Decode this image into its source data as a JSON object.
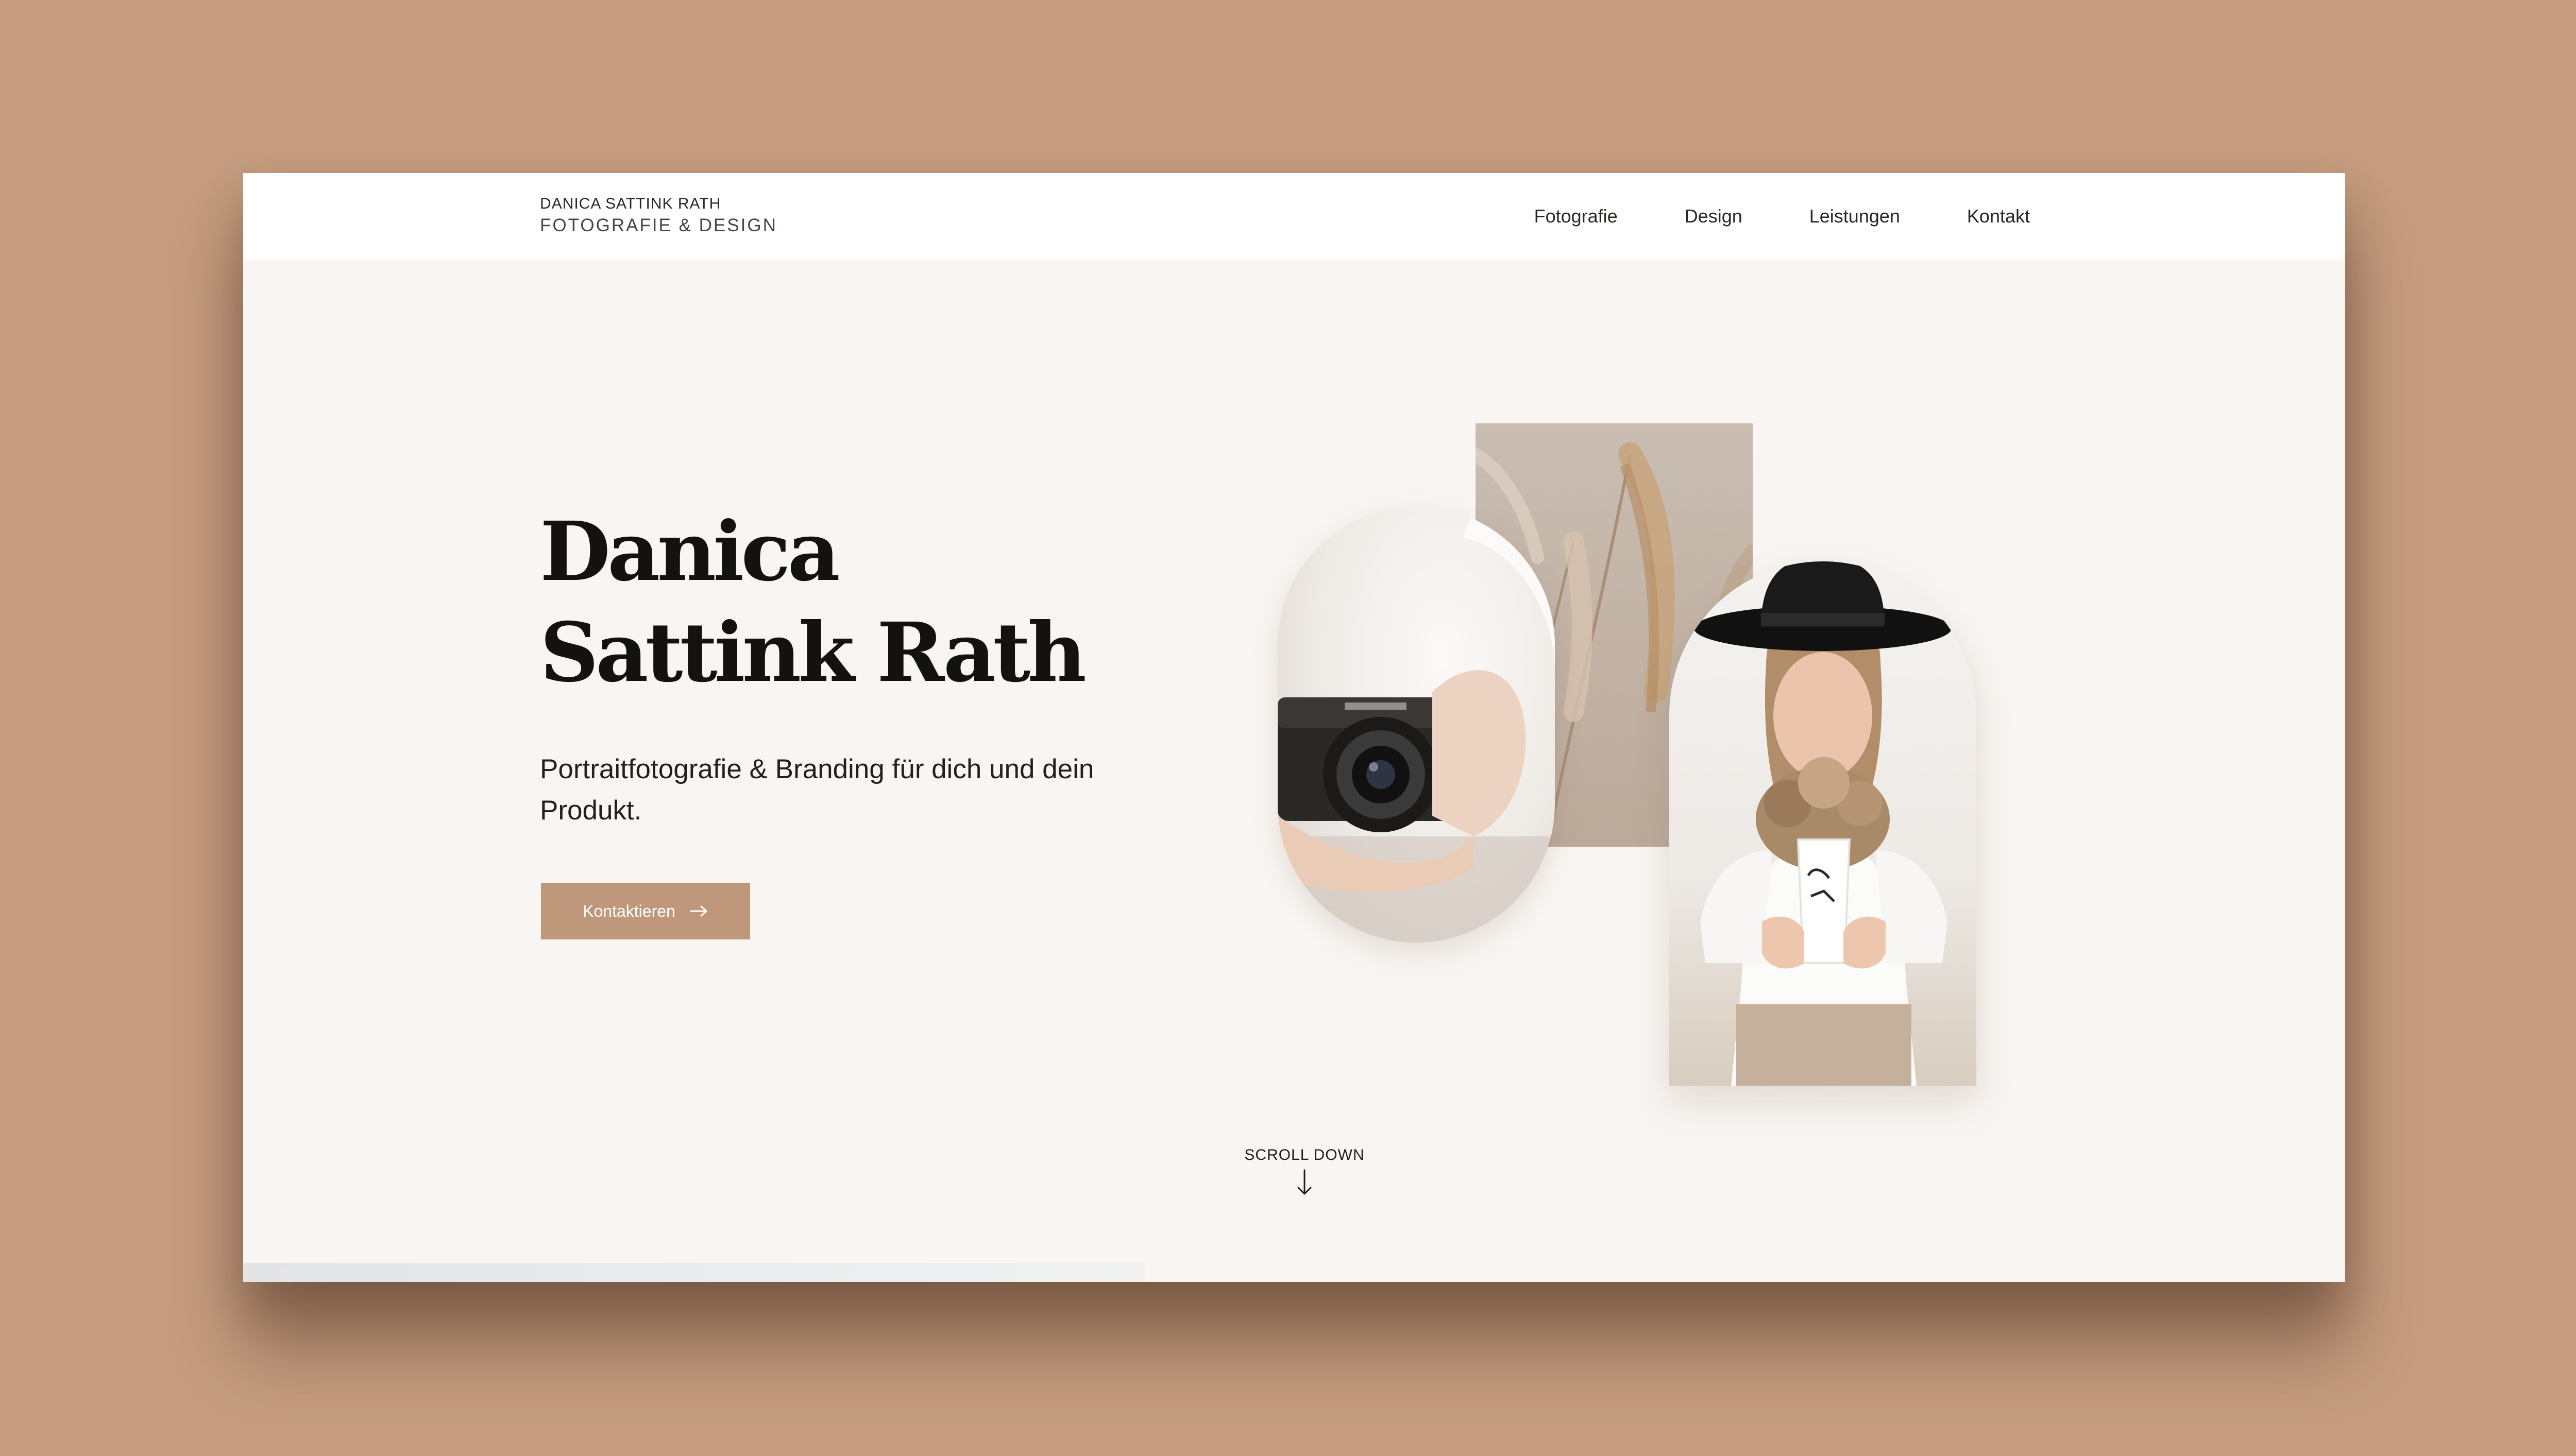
{
  "header": {
    "logo_line1": "DANICA SATTINK RATH",
    "logo_line2": "FOTOGRAFIE & DESIGN",
    "nav": [
      "Fotografie",
      "Design",
      "Leistungen",
      "Kontakt"
    ]
  },
  "hero": {
    "title_line1": "Danica",
    "title_line2": "Sattink Rath",
    "subtitle": "Portraitfotografie & Branding für dich und dein Produkt.",
    "cta_label": "Kontaktieren"
  },
  "scroll": {
    "label": "SCROLL DOWN"
  },
  "colors": {
    "backdrop": "#c59c7f",
    "page_bg": "#f8f5f2",
    "accent": "#bf977b",
    "text": "#141210"
  },
  "icons": {
    "cta": "arrow-right-icon",
    "scroll": "arrow-down-icon"
  }
}
